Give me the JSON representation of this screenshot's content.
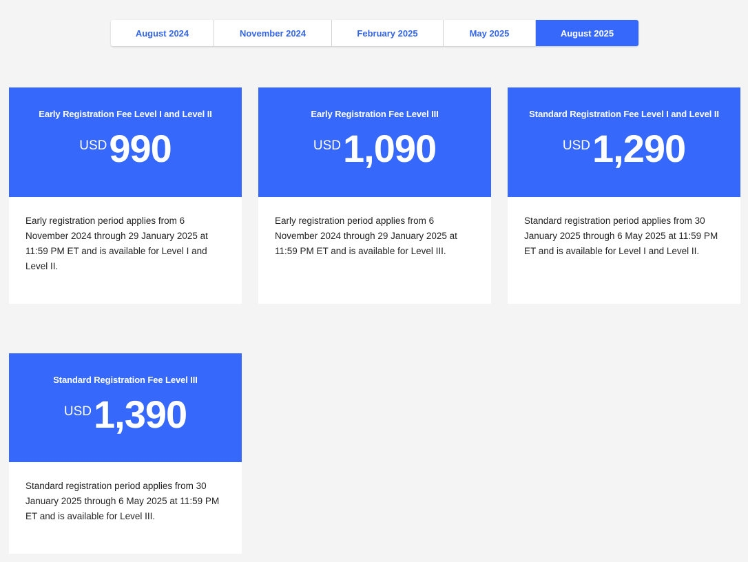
{
  "tabs": [
    {
      "label": "August 2024",
      "active": false
    },
    {
      "label": "November 2024",
      "active": false
    },
    {
      "label": "February 2025",
      "active": false
    },
    {
      "label": "May 2025",
      "active": false
    },
    {
      "label": "August 2025",
      "active": true
    }
  ],
  "cards": [
    {
      "title": "Early Registration Fee Level I and Level II",
      "currency": "USD",
      "amount": "990",
      "description": "Early registration period applies from 6 November 2024 through 29 January 2025 at 11:59 PM ET and is available for Level I and Level II."
    },
    {
      "title": "Early Registration Fee Level III",
      "currency": "USD",
      "amount": "1,090",
      "description": "Early registration period applies from 6 November 2024 through 29 January 2025 at 11:59 PM ET and is available for Level III."
    },
    {
      "title": "Standard Registration Fee Level I and Level II",
      "currency": "USD",
      "amount": "1,290",
      "description": "Standard registration period applies from 30 January 2025 through 6 May 2025 at 11:59 PM ET and is available for Level I and Level II."
    },
    {
      "title": "Standard Registration Fee Level III",
      "currency": "USD",
      "amount": "1,390",
      "description": "Standard registration period applies from 30 January 2025 through 6 May 2025 at 11:59 PM ET and is available for Level III."
    }
  ],
  "colors": {
    "accent": "#3568fb",
    "tab_text": "#3466e6",
    "background": "#f4f4f4"
  }
}
